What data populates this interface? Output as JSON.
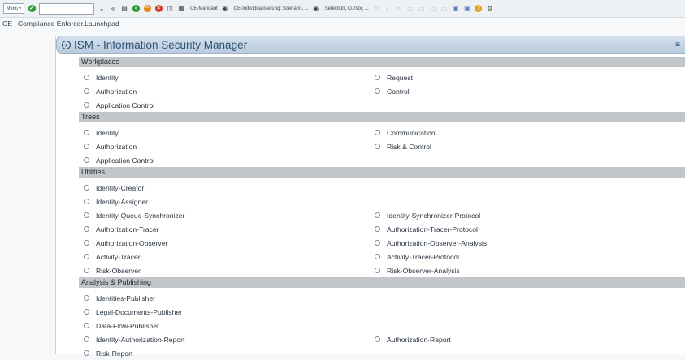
{
  "toolbar": {
    "menu_label": "Menü",
    "okcode_value": "",
    "texts": [
      "CE-Mandant",
      "CE-Individualisierung: Scenario, ...",
      "Selection, Cursor, ..."
    ]
  },
  "window_title": "CE | Compliance Enforcer.Launchpad",
  "panel": {
    "title": "ISM - Information Security Manager",
    "sections": [
      {
        "title": "Workplaces",
        "rows": [
          [
            "Identity",
            "Request"
          ],
          [
            "Authorization",
            "Control"
          ],
          [
            "Application Control",
            ""
          ]
        ]
      },
      {
        "title": "Trees",
        "rows": [
          [
            "Identity",
            "Communication"
          ],
          [
            "Authorization",
            "Risk & Control"
          ],
          [
            "Application Control",
            ""
          ]
        ]
      },
      {
        "title": "Utilities",
        "rows": [
          [
            "Identity-Creator",
            ""
          ],
          [
            "Identity-Assigner",
            ""
          ],
          [
            "Identity-Queue-Synchronizer",
            "Identity-Synchronizer-Protocol"
          ],
          [
            "Authorization-Tracer",
            "Authorization-Tracer-Protocol"
          ],
          [
            "Authorization-Observer",
            "Authorization-Observer-Analysis"
          ],
          [
            "Activity-Tracer",
            "Activity-Tracer-Protocol"
          ],
          [
            "Risk-Observer",
            "Risk-Observer-Analysis"
          ]
        ]
      },
      {
        "title": "Analysis & Publishing",
        "rows": [
          [
            "Identities-Publisher",
            ""
          ],
          [
            "Legal-Documents-Publisher",
            ""
          ],
          [
            "Data-Flow-Publisher",
            ""
          ],
          [
            "Identity-Authorization-Report",
            "Authorization-Report"
          ],
          [
            "Risk-Report",
            ""
          ]
        ]
      }
    ]
  }
}
